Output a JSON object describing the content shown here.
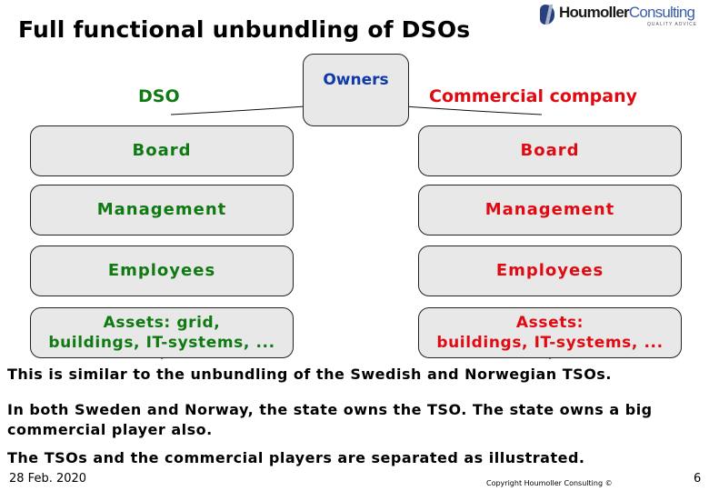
{
  "title": "Full functional unbundling of DSOs",
  "logo": {
    "name_bold": "Houmoller",
    "name_light": "Consulting",
    "tagline": "QUALITY ADVICE"
  },
  "diagram": {
    "root": {
      "label": "Owners",
      "color": "#0f3aa8"
    },
    "left": {
      "heading": "DSO",
      "color": "#0f7a12",
      "boxes": [
        "Board",
        "Management",
        "Employees",
        "Assets: grid,\nbuildings, IT-systems, ..."
      ]
    },
    "right": {
      "heading": "Commercial company",
      "color": "#e00b12",
      "boxes": [
        "Board",
        "Management",
        "Employees",
        "Assets:\nbuildings, IT-systems, ..."
      ]
    }
  },
  "body": {
    "p1": "This is similar to the unbundling of the Swedish and Norwegian TSOs.",
    "p2": "In both Sweden and Norway, the state owns the TSO. The state owns a big commercial player also.",
    "p3": "The TSOs and the commercial players are separated as illustrated."
  },
  "footer": {
    "date": "28 Feb. 2020",
    "copyright": "Copyright Houmoller Consulting ©",
    "page": "6"
  }
}
